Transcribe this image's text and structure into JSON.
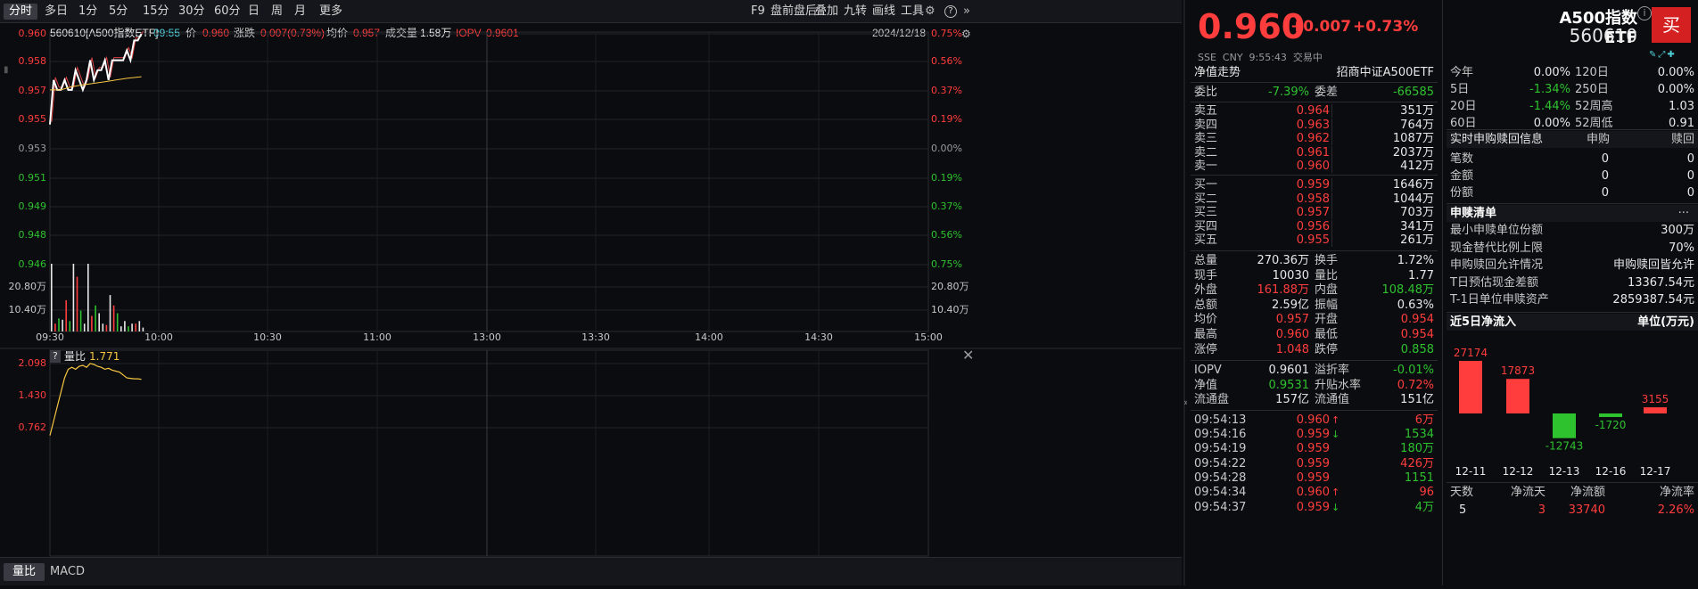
{
  "toolbar": {
    "left_items": [
      "分时",
      "多日",
      "1分",
      "5分",
      "15分",
      "30分",
      "60分",
      "日",
      "周",
      "月",
      "更多"
    ],
    "active_index": 0,
    "right_items": [
      "F9",
      "盘前盘后",
      "叠加",
      "九转",
      "画线",
      "工具"
    ]
  },
  "chart_header": {
    "code_name": "560610[A500指数ETF]",
    "time": "09:55",
    "price_label": "价",
    "price": "0.960",
    "change_label": "涨跌",
    "change": "0.007(0.73%)",
    "avg_label": "均价",
    "avg": "0.957",
    "volume_label": "成交量",
    "volume": "1.58万",
    "iopv_label": "IOPV",
    "iopv": "0.9601",
    "date": "2024/12/18"
  },
  "price_axis": {
    "left": [
      "0.960",
      "0.958",
      "0.957",
      "0.955",
      "0.953",
      "0.951",
      "0.949",
      "0.948",
      "0.946"
    ],
    "right": [
      "0.75%",
      "0.56%",
      "0.37%",
      "0.19%",
      "0.00%",
      "0.19%",
      "0.37%",
      "0.56%",
      "0.75%"
    ],
    "colors": [
      "#ff3d3d",
      "#ff3d3d",
      "#ff3d3d",
      "#ff3d3d",
      "#9a9a9a",
      "#2fc22f",
      "#2fc22f",
      "#2fc22f",
      "#2fc22f"
    ]
  },
  "volume_axis": {
    "left": [
      "20.80万",
      "10.40万"
    ],
    "right": [
      "20.80万",
      "10.40万"
    ]
  },
  "time_axis": [
    "09:30",
    "10:00",
    "10:30",
    "11:00",
    "13:00",
    "13:30",
    "14:00",
    "14:30",
    "15:00"
  ],
  "sub_chart": {
    "help": "?",
    "label": "量比",
    "value": "1.771",
    "axis": [
      "2.098",
      "1.430",
      "0.762"
    ]
  },
  "bottom_tabs": [
    "量比",
    "MACD"
  ],
  "quote": {
    "price": "0.960",
    "change": "+0.007",
    "pct": "+0.73%",
    "name": "A500指数ETF",
    "code": "560610",
    "info": "SSE  CNY  9:55:43  交易中",
    "buy_button": "买"
  },
  "nav": {
    "label": "净值走势",
    "index": "招商中证A500ETF"
  },
  "weibi": {
    "label1": "委比",
    "val1": "-7.39%",
    "label2": "委差",
    "val2": "-66585"
  },
  "sells": [
    {
      "label": "卖五",
      "price": "0.964",
      "vol": "351万"
    },
    {
      "label": "卖四",
      "price": "0.963",
      "vol": "764万"
    },
    {
      "label": "卖三",
      "price": "0.962",
      "vol": "1087万"
    },
    {
      "label": "卖二",
      "price": "0.961",
      "vol": "2037万"
    },
    {
      "label": "卖一",
      "price": "0.960",
      "vol": "412万"
    }
  ],
  "buys": [
    {
      "label": "买一",
      "price": "0.959",
      "vol": "1646万"
    },
    {
      "label": "买二",
      "price": "0.958",
      "vol": "1044万"
    },
    {
      "label": "买三",
      "price": "0.957",
      "vol": "703万"
    },
    {
      "label": "买四",
      "price": "0.956",
      "vol": "341万"
    },
    {
      "label": "买五",
      "price": "0.955",
      "vol": "261万"
    }
  ],
  "stats": [
    {
      "l1": "总量",
      "v1": "270.36万",
      "c1": "white",
      "l2": "换手",
      "v2": "1.72%",
      "c2": "white"
    },
    {
      "l1": "现手",
      "v1": "10030",
      "c1": "white",
      "l2": "量比",
      "v2": "1.77",
      "c2": "white"
    },
    {
      "l1": "外盘",
      "v1": "161.88万",
      "c1": "red",
      "l2": "内盘",
      "v2": "108.48万",
      "c2": "green"
    },
    {
      "l1": "总额",
      "v1": "2.59亿",
      "c1": "white",
      "l2": "振幅",
      "v2": "0.63%",
      "c2": "white"
    },
    {
      "l1": "均价",
      "v1": "0.957",
      "c1": "red",
      "l2": "开盘",
      "v2": "0.954",
      "c2": "red"
    },
    {
      "l1": "最高",
      "v1": "0.960",
      "c1": "red",
      "l2": "最低",
      "v2": "0.954",
      "c2": "red"
    },
    {
      "l1": "涨停",
      "v1": "1.048",
      "c1": "red",
      "l2": "跌停",
      "v2": "0.858",
      "c2": "green"
    }
  ],
  "stats2": [
    {
      "l1": "IOPV",
      "v1": "0.9601",
      "c1": "white",
      "l2": "溢折率",
      "v2": "-0.01%",
      "c2": "green"
    },
    {
      "l1": "净值",
      "v1": "0.9531",
      "c1": "green",
      "l2": "升贴水率",
      "v2": "0.72%",
      "c2": "red"
    },
    {
      "l1": "流通盘",
      "v1": "157亿",
      "c1": "white",
      "l2": "流通值",
      "v2": "151亿",
      "c2": "white"
    }
  ],
  "ticks": [
    {
      "t": "09:54:13",
      "p": "0.960",
      "d": "up",
      "v": "6万",
      "vc": "red"
    },
    {
      "t": "09:54:16",
      "p": "0.959",
      "d": "down",
      "v": "1534",
      "vc": "green"
    },
    {
      "t": "09:54:19",
      "p": "0.959",
      "d": "",
      "v": "180万",
      "vc": "green"
    },
    {
      "t": "09:54:22",
      "p": "0.959",
      "d": "",
      "v": "426万",
      "vc": "red"
    },
    {
      "t": "09:54:28",
      "p": "0.959",
      "d": "",
      "v": "1151",
      "vc": "green"
    },
    {
      "t": "09:54:34",
      "p": "0.960",
      "d": "up",
      "v": "96",
      "vc": "red"
    },
    {
      "t": "09:54:37",
      "p": "0.959",
      "d": "down",
      "v": "4万",
      "vc": "green"
    }
  ],
  "perf": [
    {
      "l1": "今年",
      "v1": "0.00%",
      "c1": "white",
      "l2": "120日",
      "v2": "0.00%",
      "c2": "white"
    },
    {
      "l1": "5日",
      "v1": "-1.34%",
      "c1": "green",
      "l2": "250日",
      "v2": "0.00%",
      "c2": "white"
    },
    {
      "l1": "20日",
      "v1": "-1.44%",
      "c1": "green",
      "l2": "52周高",
      "v2": "1.03",
      "c2": "white"
    },
    {
      "l1": "60日",
      "v1": "0.00%",
      "c1": "white",
      "l2": "52周低",
      "v2": "0.91",
      "c2": "white"
    }
  ],
  "subscribe_info": {
    "header": "实时申购赎回信息",
    "col1": "申购",
    "col2": "赎回",
    "rows": [
      {
        "l": "笔数",
        "a": "0",
        "b": "0"
      },
      {
        "l": "金额",
        "a": "0",
        "b": "0"
      },
      {
        "l": "份额",
        "a": "0",
        "b": "0"
      }
    ]
  },
  "subscribe_list": {
    "header": "申赎清单",
    "more": "···",
    "rows": [
      {
        "l": "最小申赎单位份额",
        "v": "300万"
      },
      {
        "l": "现金替代比例上限",
        "v": "70%"
      },
      {
        "l": "申购赎回允许情况",
        "v": "申购赎回皆允许"
      },
      {
        "l": "T日预估现金差额",
        "v": "13367.54元"
      },
      {
        "l": "T-1日单位申赎资产",
        "v": "2859387.54元"
      }
    ]
  },
  "inflow": {
    "header": "近5日净流入",
    "unit": "单位(万元)",
    "summary_headers": [
      "天数",
      "净流天",
      "净流额",
      "净流率"
    ],
    "summary_values": [
      "5",
      "3",
      "33740",
      "2.26%"
    ]
  },
  "chart_data": [
    {
      "type": "line",
      "title": "",
      "x_range": [
        "09:30",
        "15:00"
      ],
      "ylim": [
        0.9455,
        0.9605
      ],
      "series": [
        {
          "color": "#ffffff",
          "x": [
            "09:30",
            "09:31",
            "09:32",
            "09:33",
            "09:34",
            "09:35",
            "09:36",
            "09:37",
            "09:38",
            "09:39",
            "09:40",
            "09:41",
            "09:42",
            "09:43",
            "09:44",
            "09:45",
            "09:46",
            "09:47",
            "09:48",
            "09:49",
            "09:50",
            "09:51",
            "09:52",
            "09:53",
            "09:54",
            "09:55"
          ],
          "values": [
            0.9545,
            0.9572,
            0.9566,
            0.9566,
            0.9572,
            0.9566,
            0.9566,
            0.9578,
            0.9572,
            0.9566,
            0.9572,
            0.9584,
            0.9572,
            0.9578,
            0.9578,
            0.9584,
            0.9572,
            0.9584,
            0.9584,
            0.9584,
            0.9584,
            0.959,
            0.9584,
            0.9596,
            0.9596,
            0.96
          ]
        },
        {
          "color": "#f5c542",
          "x": [
            "09:30",
            "09:33",
            "09:36",
            "09:39",
            "09:42",
            "09:45",
            "09:48",
            "09:51",
            "09:55"
          ],
          "values": [
            0.9566,
            0.9566,
            0.9568,
            0.9569,
            0.957,
            0.9571,
            0.9572,
            0.9573,
            0.9574
          ]
        }
      ]
    },
    {
      "type": "bar",
      "title": "",
      "ylabel": "",
      "ylim": [
        0,
        26.0
      ],
      "x": [
        "09:30",
        "09:31",
        "09:32",
        "09:33",
        "09:34",
        "09:35",
        "09:36",
        "09:37",
        "09:38",
        "09:39",
        "09:40",
        "09:41",
        "09:42",
        "09:43",
        "09:44",
        "09:45",
        "09:46",
        "09:47",
        "09:48",
        "09:49",
        "09:50",
        "09:51",
        "09:52",
        "09:53",
        "09:54",
        "09:55"
      ],
      "values": [
        26.0,
        3.0,
        5.0,
        4.5,
        12.0,
        4.0,
        26.0,
        21.0,
        8.0,
        3.0,
        26.0,
        6.0,
        10.0,
        7.0,
        3.0,
        2.5,
        14.0,
        10.0,
        7.0,
        2.0,
        4.0,
        2.0,
        3.0,
        3.0,
        4.0,
        1.5
      ],
      "colors": [
        "w",
        "r",
        "g",
        "w",
        "r",
        "g",
        "w",
        "r",
        "g",
        "w",
        "w",
        "r",
        "g",
        "w",
        "w",
        "r",
        "w",
        "r",
        "g",
        "w",
        "w",
        "g",
        "w",
        "r",
        "w",
        "w"
      ]
    },
    {
      "type": "line",
      "title": "",
      "ylim": [
        0.6,
        2.15
      ],
      "series": [
        {
          "name": "量比",
          "color": "#f5c542",
          "x": [
            "09:30",
            "09:31",
            "09:32",
            "09:33",
            "09:34",
            "09:35",
            "09:36",
            "09:37",
            "09:38",
            "09:39",
            "09:40",
            "09:41",
            "09:42",
            "09:43",
            "09:44",
            "09:45",
            "09:46",
            "09:47",
            "09:48",
            "09:49",
            "09:50",
            "09:51",
            "09:52",
            "09:53",
            "09:54",
            "09:55"
          ],
          "values": [
            0.6,
            0.9,
            1.2,
            1.5,
            1.8,
            1.98,
            2.02,
            1.98,
            2.04,
            2.06,
            2.02,
            2.1,
            2.08,
            2.04,
            2.02,
            1.98,
            2.0,
            1.96,
            1.94,
            1.92,
            1.86,
            1.8,
            1.79,
            1.78,
            1.78,
            1.77
          ]
        }
      ]
    },
    {
      "type": "bar",
      "title": "",
      "categories": [
        "12-11",
        "12-12",
        "12-13",
        "12-16",
        "12-17"
      ],
      "values": [
        27174,
        17873,
        -12743,
        -1720,
        3155
      ]
    }
  ]
}
